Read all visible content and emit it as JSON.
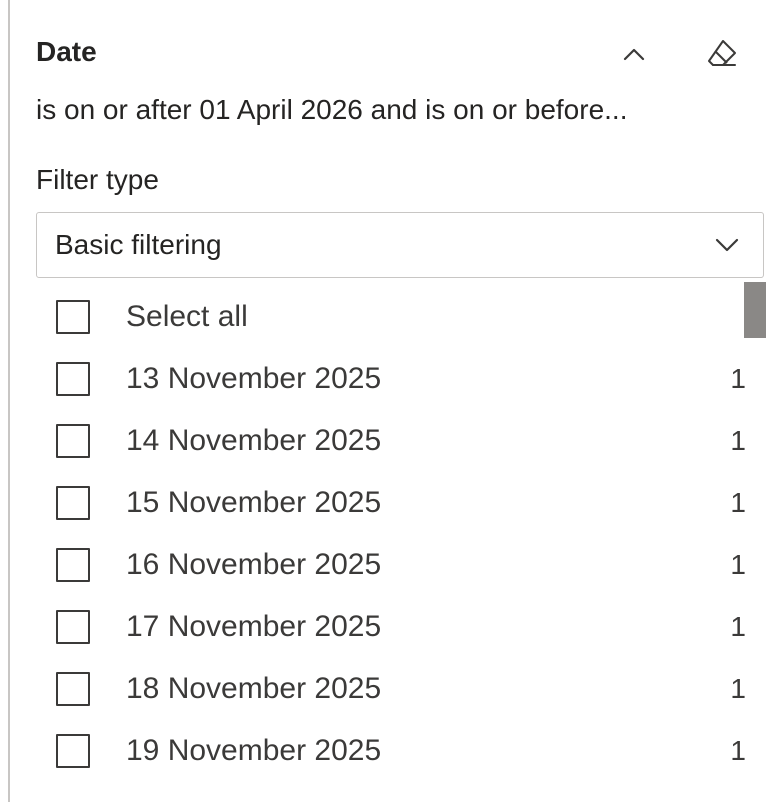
{
  "filter_card": {
    "title": "Date",
    "summary": "is on or after 01 April 2026 and is on or before...",
    "collapse_icon": "chevron-up-icon",
    "clear_icon": "eraser-icon",
    "filter_type_label": "Filter type",
    "filter_type_value": "Basic filtering",
    "dropdown_icon": "chevron-down-icon"
  },
  "list": {
    "select_all_label": "Select all",
    "items": [
      {
        "label": "13 November 2025",
        "count": "1"
      },
      {
        "label": "14 November 2025",
        "count": "1"
      },
      {
        "label": "15 November 2025",
        "count": "1"
      },
      {
        "label": "16 November 2025",
        "count": "1"
      },
      {
        "label": "17 November 2025",
        "count": "1"
      },
      {
        "label": "18 November 2025",
        "count": "1"
      },
      {
        "label": "19 November 2025",
        "count": "1"
      }
    ]
  },
  "colors": {
    "text": "#252423",
    "border": "#c8c6c4",
    "checkbox_border": "#3b3a39",
    "scrollbar": "#8a8886"
  }
}
